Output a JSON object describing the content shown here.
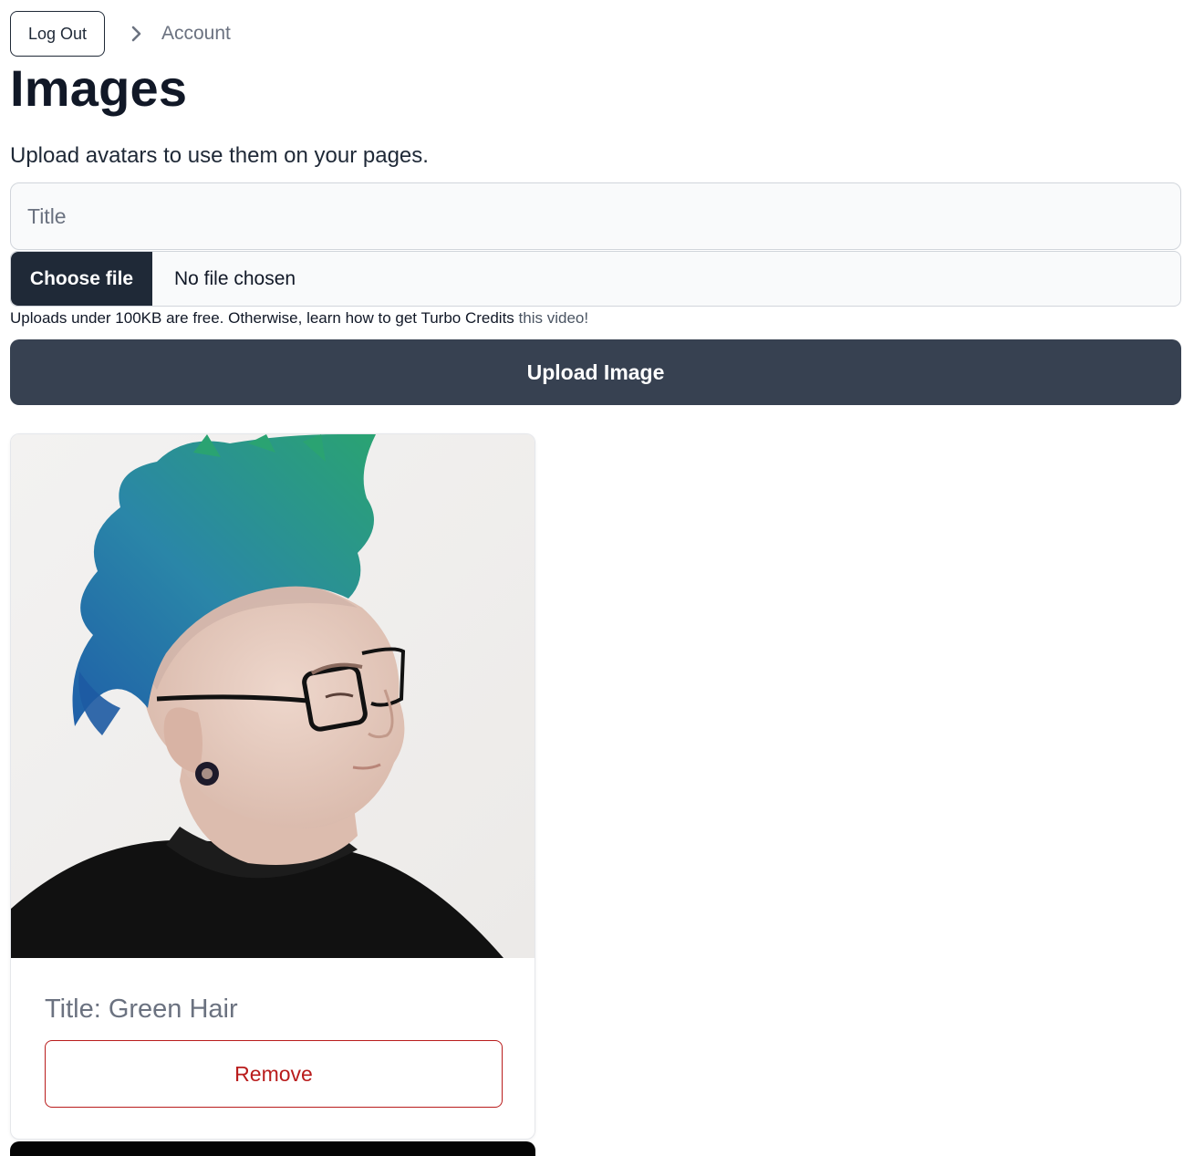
{
  "nav": {
    "logout_label": "Log Out",
    "breadcrumb_current": "Account"
  },
  "page": {
    "title": "Images",
    "subtitle": "Upload avatars to use them on your pages."
  },
  "form": {
    "title_placeholder": "Title",
    "title_value": "",
    "choose_file_label": "Choose file",
    "file_status": "No file chosen",
    "help_prefix": "Uploads under 100KB are free. Otherwise, learn how to get Turbo Credits ",
    "help_link": "this video!",
    "upload_label": "Upload Image"
  },
  "images": [
    {
      "title_label": "Title: Green Hair",
      "remove_label": "Remove"
    }
  ],
  "colors": {
    "primary_dark": "#1f2937",
    "upload_button": "#374151",
    "danger": "#b91c1c",
    "muted_text": "#6b7280"
  }
}
